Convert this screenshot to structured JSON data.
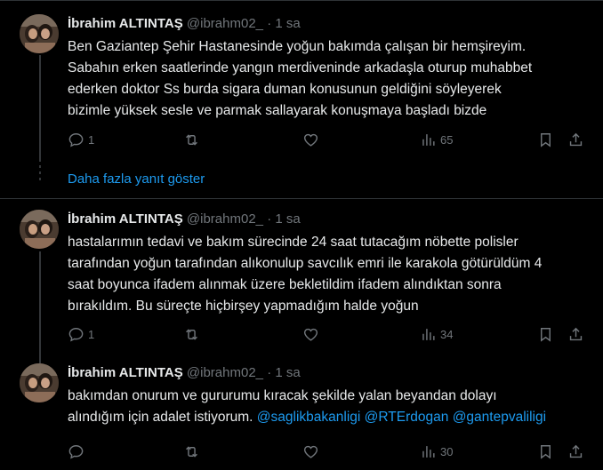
{
  "thread": {
    "show_more_replies": "Daha fazla yanıt göster"
  },
  "tweets": [
    {
      "name": "İbrahim ALTINTAŞ",
      "handle": "@ibrahm02_",
      "separator": "·",
      "time": "1 sa",
      "lines": [
        "Ben Gaziantep Şehir Hastanesinde yoğun bakımda çalışan bir hemşireyim.",
        "Sabahın erken saatlerinde yangın merdiveninde arkadaşla oturup muhabbet",
        "ederken doktor Ss burda sigara duman konusunun geldiğini söyleyerek",
        "bizimle yüksek sesle ve parmak sallayarak konuşmaya başladı bizde"
      ],
      "replies": "1",
      "retweets": "",
      "likes": "",
      "views": "65"
    },
    {
      "name": "İbrahim ALTINTAŞ",
      "handle": "@ibrahm02_",
      "separator": "·",
      "time": "1 sa",
      "lines": [
        "hastalarımın tedavi ve bakım sürecinde 24 saat tutacağım nöbette polisler",
        "tarafından yoğun tarafından alıkonulup savcılık emri ile karakola götürüldüm 4",
        "saat boyunca ifadem alınmak üzere bekletildim ifadem alındıktan sonra",
        "bırakıldım. Bu süreçte hiçbirşey yapmadığım halde yoğun"
      ],
      "replies": "1",
      "retweets": "",
      "likes": "",
      "views": "34"
    },
    {
      "name": "İbrahim ALTINTAŞ",
      "handle": "@ibrahm02_",
      "separator": "·",
      "time": "1 sa",
      "lines": [
        "bakımdan onurum ve gururumu kıracak şekilde yalan beyandan dolayı"
      ],
      "last_line_text": "alındığım için adalet istiyorum.",
      "mentions": [
        "@saglikbakanligi",
        "@RTErdogan",
        "@gantepvaliligi"
      ],
      "replies": "",
      "retweets": "",
      "likes": "",
      "views": "30"
    }
  ],
  "colors": {
    "background": "#000000",
    "text": "#e7e9ea",
    "muted": "#71767b",
    "link": "#1d9bf0",
    "divider": "#2f3336"
  },
  "icons": [
    "reply-icon",
    "retweet-icon",
    "like-icon",
    "views-icon",
    "bookmark-icon",
    "share-icon"
  ]
}
